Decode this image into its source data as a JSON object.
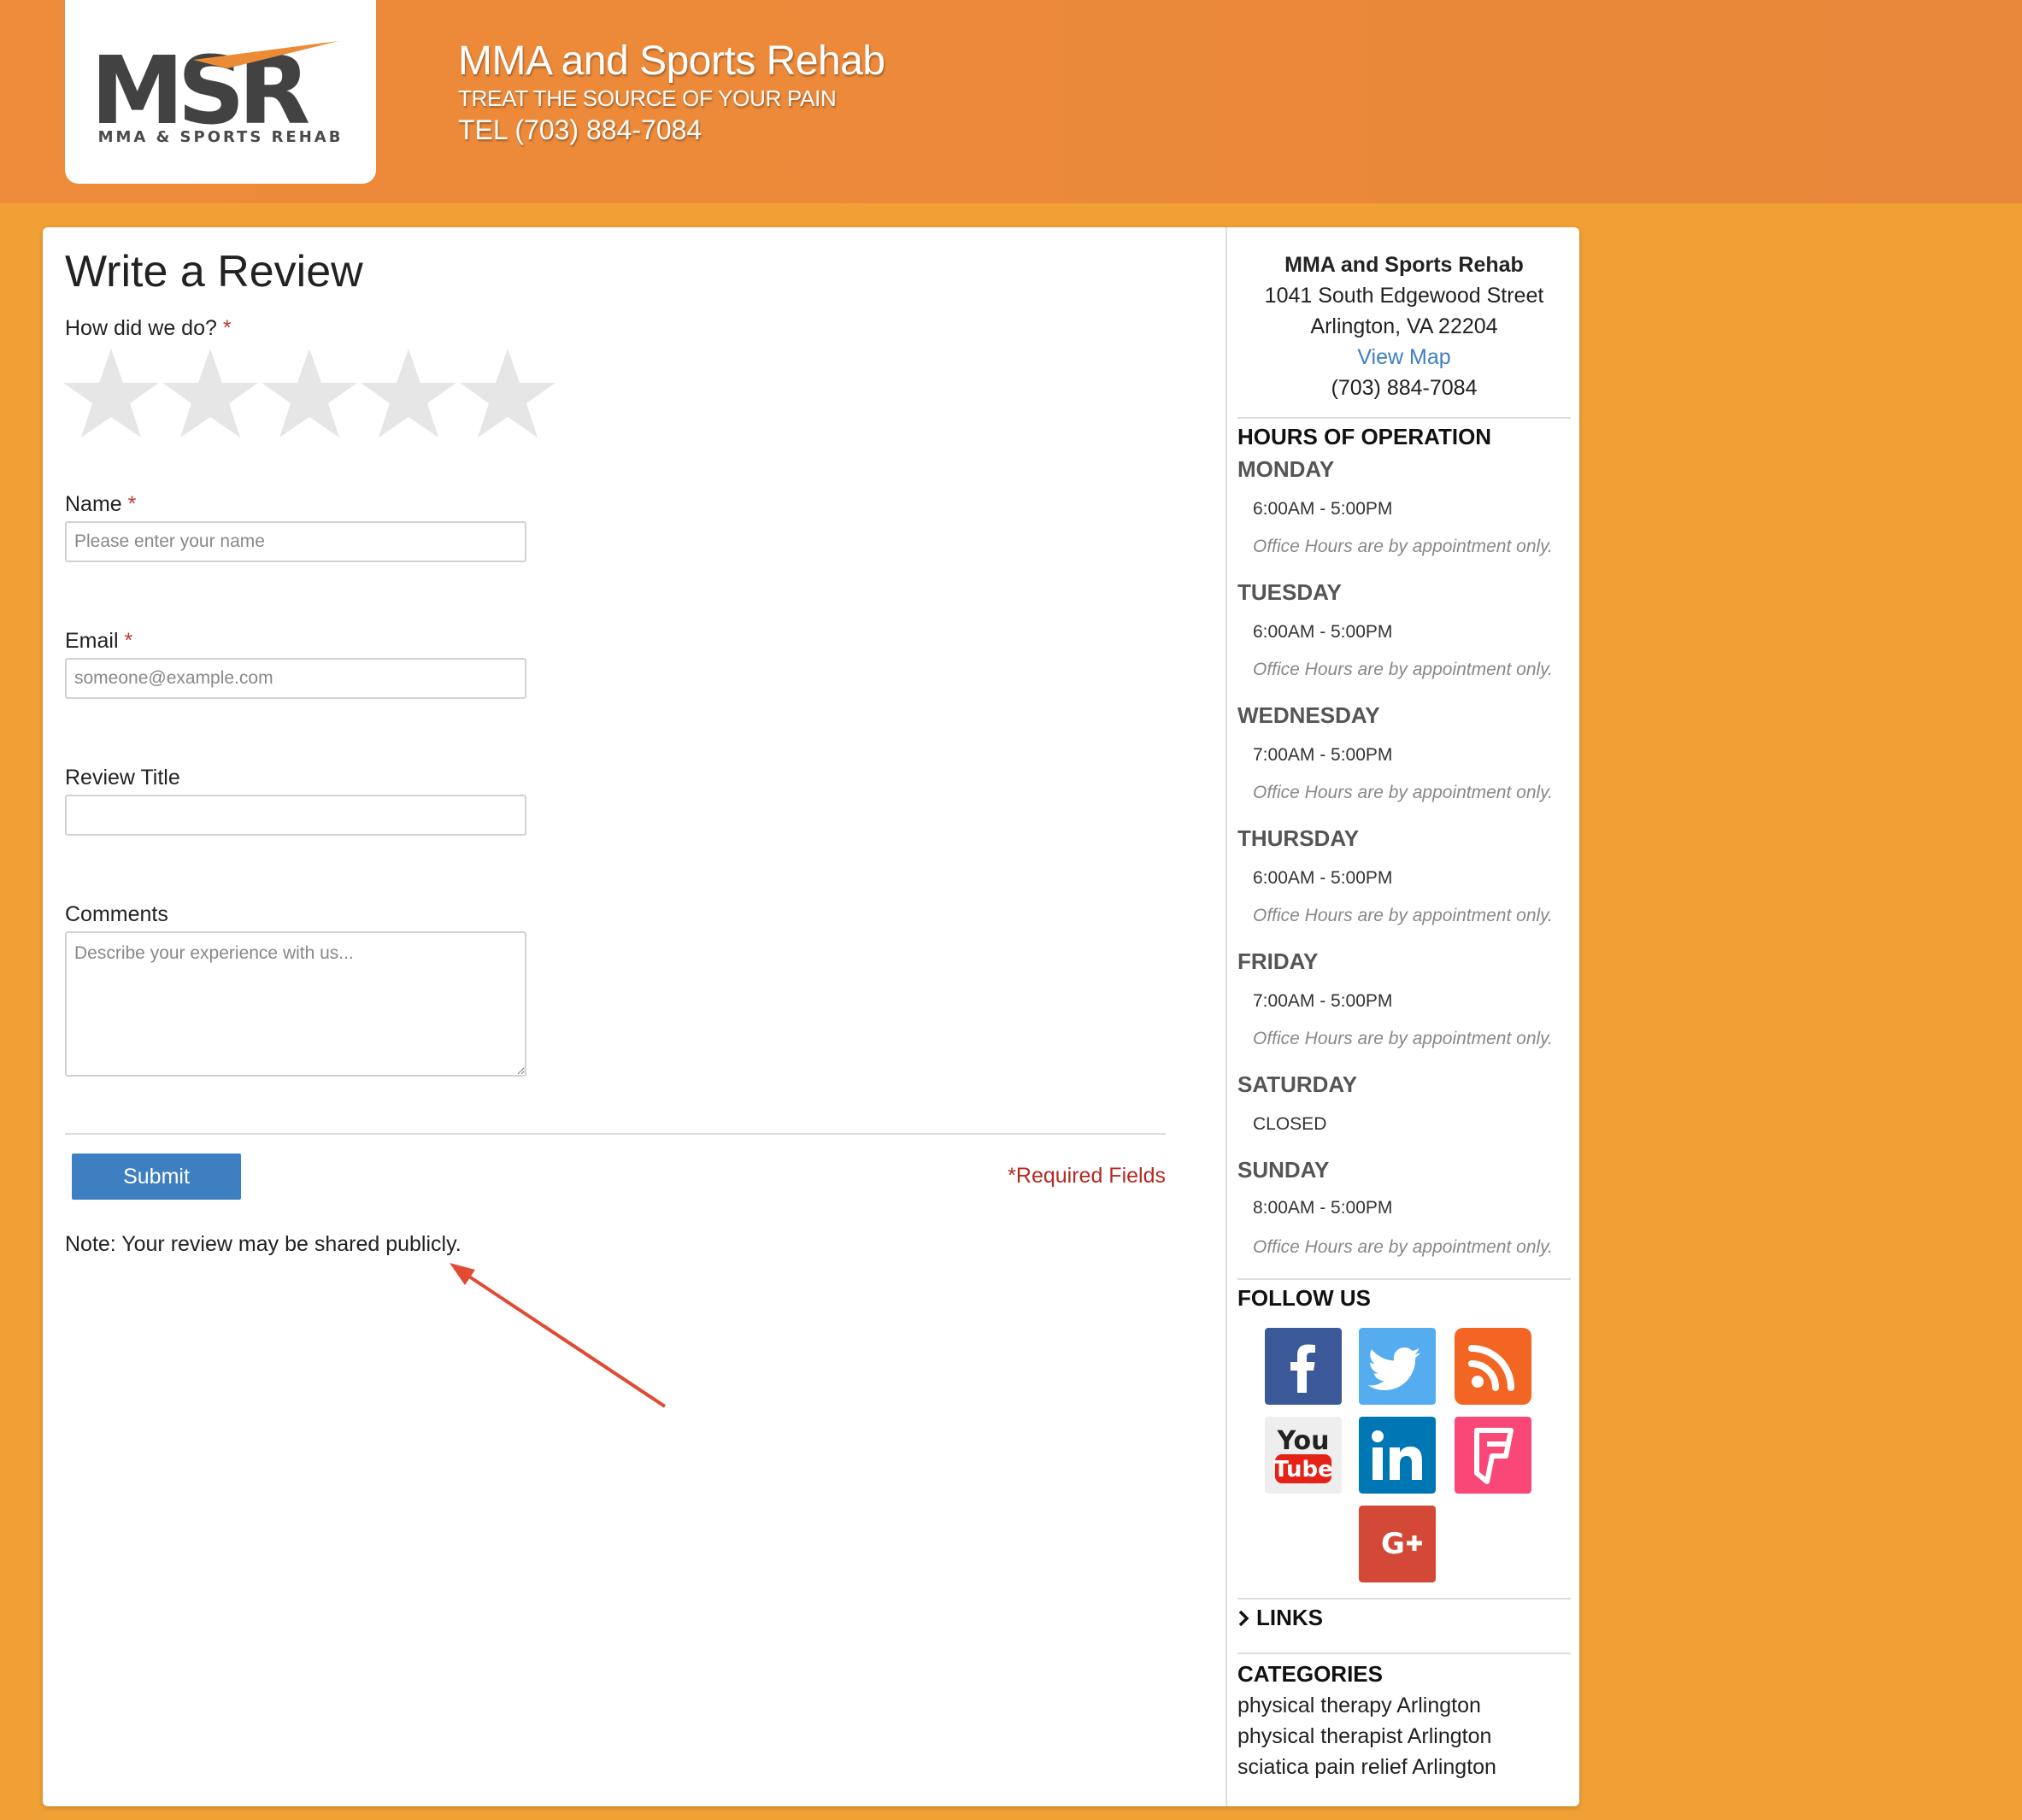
{
  "header": {
    "logo_text": "MSR",
    "logo_sub": "MMA & SPORTS REHAB",
    "title": "MMA and Sports Rehab",
    "tagline": "TREAT THE SOURCE OF YOUR PAIN",
    "tel": "TEL (703) 884-7084"
  },
  "form": {
    "title": "Write a Review",
    "rating_label": "How did we do?",
    "required_mark": "*",
    "rating_value": 0,
    "rating_max": 5,
    "name_label": "Name",
    "name_placeholder": "Please enter your name",
    "email_label": "Email",
    "email_placeholder": "someone@example.com",
    "review_title_label": "Review Title",
    "review_title_placeholder": "",
    "comments_label": "Comments",
    "comments_placeholder": "Describe your experience with us...",
    "submit_label": "Submit",
    "required_note": "*Required Fields",
    "public_note": "Note: Your review may be shared publicly."
  },
  "sidebar": {
    "business_name": "MMA and Sports Rehab",
    "street": "1041 South Edgewood Street",
    "city": "Arlington, VA 22204",
    "map_link": "View Map",
    "phone": "(703) 884-7084",
    "hours_heading": "HOURS OF OPERATION",
    "days": [
      {
        "day": "MONDAY",
        "hours": "6:00AM - 5:00PM",
        "note": "Office Hours are by appointment only."
      },
      {
        "day": "TUESDAY",
        "hours": "6:00AM - 5:00PM",
        "note": "Office Hours are by appointment only."
      },
      {
        "day": "WEDNESDAY",
        "hours": "7:00AM - 5:00PM",
        "note": "Office Hours are by appointment only."
      },
      {
        "day": "THURSDAY",
        "hours": "6:00AM - 5:00PM",
        "note": "Office Hours are by appointment only."
      },
      {
        "day": "FRIDAY",
        "hours": "7:00AM - 5:00PM",
        "note": "Office Hours are by appointment only."
      },
      {
        "day": "SATURDAY",
        "hours": "CLOSED"
      },
      {
        "day": "SUNDAY",
        "hours": "8:00AM - 5:00PM",
        "note": "Office Hours are by appointment only."
      }
    ],
    "follow_heading": "FOLLOW US",
    "social": [
      {
        "name": "facebook-icon",
        "color": "#3b5998"
      },
      {
        "name": "twitter-icon",
        "color": "#55acee"
      },
      {
        "name": "rss-icon",
        "color": "#f26522"
      },
      {
        "name": "youtube-icon",
        "color": "#e62117"
      },
      {
        "name": "linkedin-icon",
        "color": "#0077b5"
      },
      {
        "name": "foursquare-icon",
        "color": "#f94877"
      },
      {
        "name": "google-plus-icon",
        "color": "#d34836"
      }
    ],
    "links_label": "LINKS",
    "categories_heading": "CATEGORIES",
    "categories": [
      "physical therapy Arlington",
      "physical therapist Arlington",
      "sciatica pain relief Arlington"
    ]
  },
  "colors": {
    "page_bg": "#f0a035",
    "header_bg": "#ec893a",
    "button": "#3e7fc1",
    "required": "#b32a22",
    "annotation_arrow": "#e24a33"
  }
}
